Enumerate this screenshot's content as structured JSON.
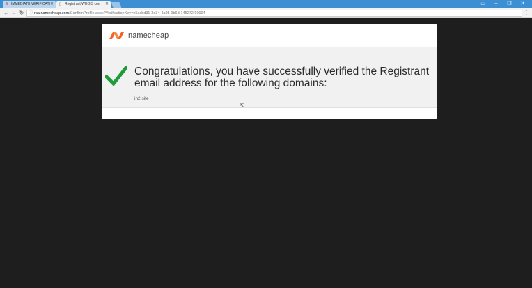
{
  "browser": {
    "tabs": [
      {
        "label": "IMMEDIATE VERIFICATI",
        "icon": "gmail-icon",
        "active": false
      },
      {
        "label": "Registrant WHOIS con",
        "icon": "page-icon",
        "active": true
      }
    ],
    "address_bar": {
      "host": "raa.namecheap.com",
      "path": "/ConfirmProfile.aspx?VerificationKey=e5acbd31-3d34-4a95-9b6d-145272f10994"
    }
  },
  "page": {
    "logo_text": "namecheap",
    "message": "Congratulations, you have successfully verified the Registrant email address for the following domains:",
    "domains": [
      "in2.site"
    ]
  },
  "colors": {
    "brand_orange": "#f26522",
    "check_green": "#1e9c3c",
    "titlebar_blue": "#3d8fd3"
  }
}
